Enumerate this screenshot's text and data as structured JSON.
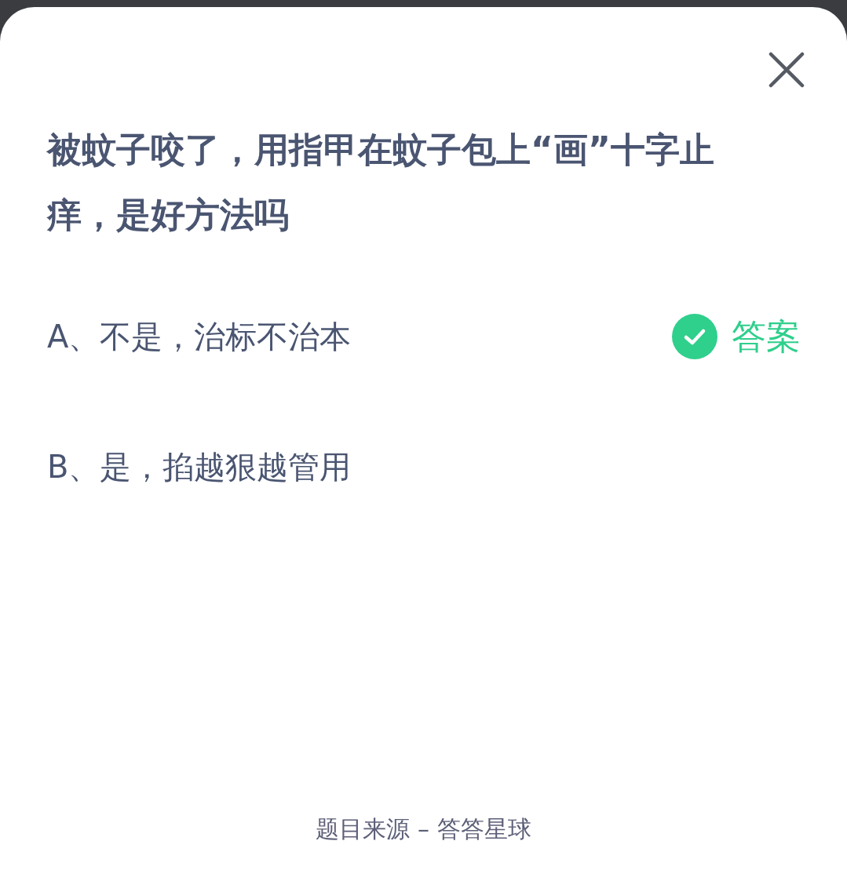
{
  "question": "被蚊子咬了，用指甲在蚊子包上“画”十字止痒，是好方法吗",
  "options": [
    {
      "label": "A、不是，治标不治本",
      "correct": true
    },
    {
      "label": "B、是，掐越狠越管用",
      "correct": false
    }
  ],
  "answer_badge": "答案",
  "source": "题目来源 – 答答星球"
}
